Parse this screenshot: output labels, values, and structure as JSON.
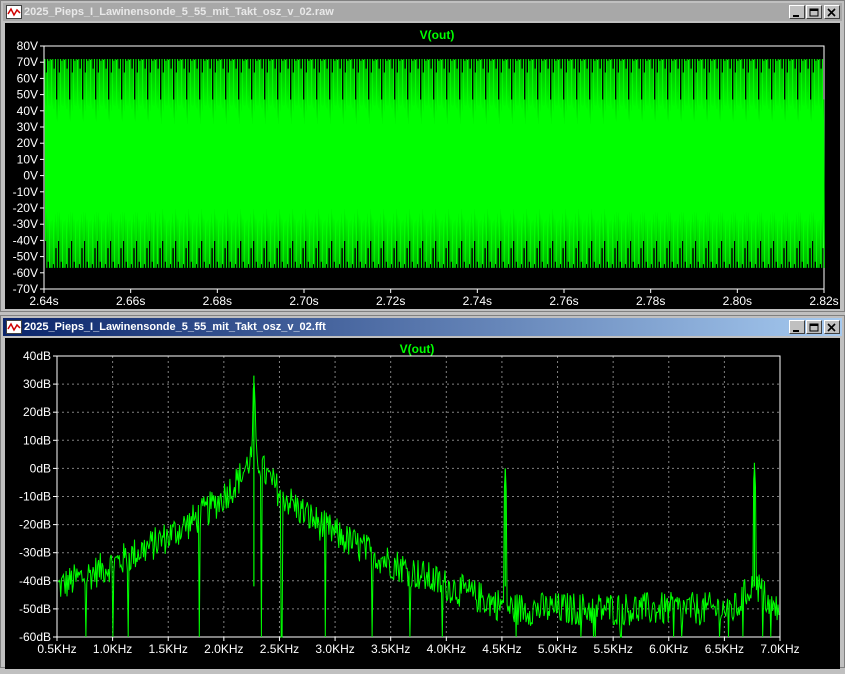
{
  "windows": [
    {
      "title": "2025_Pieps_I_Lawinensonde_5_55_mit_Takt_osz_v_02.raw",
      "active": false,
      "trace_label": "V(out)"
    },
    {
      "title": "2025_Pieps_I_Lawinensonde_5_55_mit_Takt_osz_v_02.fft",
      "active": true,
      "trace_label": "V(out)"
    }
  ],
  "colors": {
    "trace": "#00ff00",
    "background": "#000000",
    "axis_text": "#ffffff",
    "grid": "#808080"
  },
  "chart_data": [
    {
      "type": "line",
      "title": "V(out)",
      "x_ticks": [
        "2.64s",
        "2.66s",
        "2.68s",
        "2.70s",
        "2.72s",
        "2.74s",
        "2.76s",
        "2.78s",
        "2.80s",
        "2.82s"
      ],
      "y_ticks": [
        "80V",
        "70V",
        "60V",
        "50V",
        "40V",
        "30V",
        "20V",
        "10V",
        "0V",
        "-10V",
        "-20V",
        "-30V",
        "-40V",
        "-50V",
        "-60V",
        "-70V"
      ],
      "xlim": [
        2.64,
        2.82
      ],
      "ylim": [
        -70,
        80
      ],
      "signal": {
        "kind": "oscillation",
        "max": 72,
        "min": -57,
        "burst_count": 60
      },
      "grid": false
    },
    {
      "type": "line",
      "title": "V(out)",
      "x_ticks": [
        "0.5KHz",
        "1.0KHz",
        "1.5KHz",
        "2.0KHz",
        "2.5KHz",
        "3.0KHz",
        "3.5KHz",
        "4.0KHz",
        "4.5KHz",
        "5.0KHz",
        "5.5KHz",
        "6.0KHz",
        "6.5KHz",
        "7.0KHz"
      ],
      "y_ticks": [
        "40dB",
        "30dB",
        "20dB",
        "10dB",
        "0dB",
        "-10dB",
        "-20dB",
        "-30dB",
        "-40dB",
        "-50dB",
        "-60dB"
      ],
      "xlim": [
        0.5,
        7.0
      ],
      "ylim": [
        -60,
        40
      ],
      "grid": true,
      "peaks": [
        {
          "freq_khz": 2.27,
          "db": 33
        },
        {
          "freq_khz": 4.53,
          "db": 0
        },
        {
          "freq_khz": 6.77,
          "db": 2
        }
      ],
      "noise_floor_db": -50
    }
  ]
}
